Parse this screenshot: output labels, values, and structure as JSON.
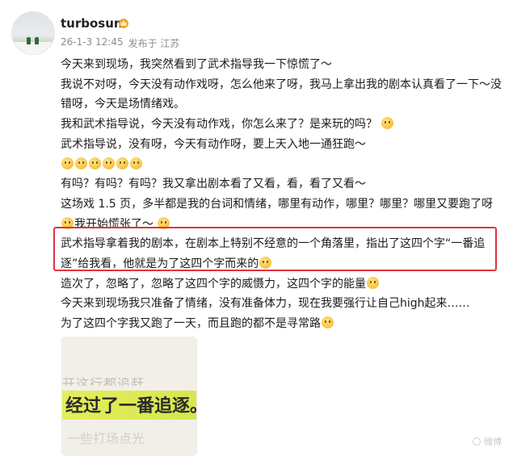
{
  "author": {
    "name": "turbosun",
    "badge_icon": "crown-badge-icon"
  },
  "meta": {
    "time": "26-1-3 12:45",
    "source": "发布于 江苏"
  },
  "post": {
    "lines": [
      "今天来到现场，我突然看到了武术指导我一下惊慌了～",
      "我说不对呀，今天没有动作戏呀，怎么他来了呀，我马上拿出我的剧本认真看了一下～没错呀，今天是场情绪戏。",
      "我和武术指导说，今天没有动作戏，你怎么来了？是来玩的吗？",
      "武术指导说，没有呀，今天有动作呀，要上天入地一通狂跑～",
      "有吗？有吗？有吗？我又拿出剧本看了又看，看，看了又看～",
      "这场戏 1.5 页，多半都是我的台词和情绪，哪里有动作，哪里？哪里？哪里又要跑了呀",
      "我开始慌张了～",
      "武术指导拿着我的剧本，在剧本上特别不经意的一个角落里，指出了这四个字“一番追逐”给我看，他就是为了这四个字而来的",
      "造次了，忽略了，忽略了这四个字的威慑力，这四个字的能量",
      "今天来到现场我只准备了情绪，没有准备体力，现在我要强行让自己high起来……",
      "为了这四个字我又跑了一天，而且跑的都不是寻常路"
    ]
  },
  "image": {
    "line_top": "开这行都追赶",
    "highlighted_text": "经过了一番追逐。",
    "line_bottom": "一些打场点光"
  },
  "watermark": {
    "text": "微博"
  },
  "colors": {
    "highlight_border": "#e0333f",
    "meta_text": "#8d8d8d",
    "text_highlight": "#dde94f"
  }
}
